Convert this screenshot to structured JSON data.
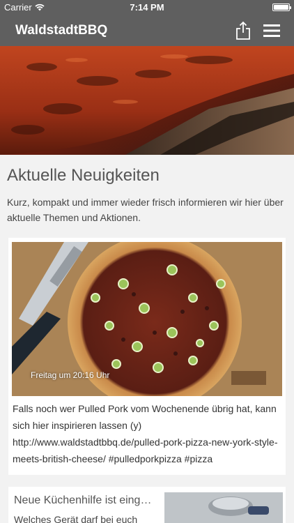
{
  "status_bar": {
    "carrier": "Carrier",
    "time": "7:14 PM"
  },
  "nav": {
    "title": "WaldstadtBBQ",
    "share_icon": "share-icon",
    "menu_icon": "hamburger-menu-icon"
  },
  "section": {
    "title": "Aktuelle Neuigkeiten",
    "intro": "Kurz, kompakt und immer wieder frisch informieren wir hier über aktuelle Themen und Aktionen."
  },
  "posts": [
    {
      "timestamp": "Freitag um 20:16 Uhr",
      "text": "Falls noch wer Pulled Pork vom Wochenende übrig hat, kann sich hier inspirieren lassen (y) http://www.waldstadtbbq.de/pulled-pork-pizza-new-york-style-meets-british-cheese/ #pulledporkpizza #pizza"
    },
    {
      "title": "Neue Küchenhilfe ist eing…",
      "text": "Welches Gerät darf bei euch"
    }
  ],
  "colors": {
    "bar": "#5f5f5f",
    "background": "#f2f2f2"
  }
}
